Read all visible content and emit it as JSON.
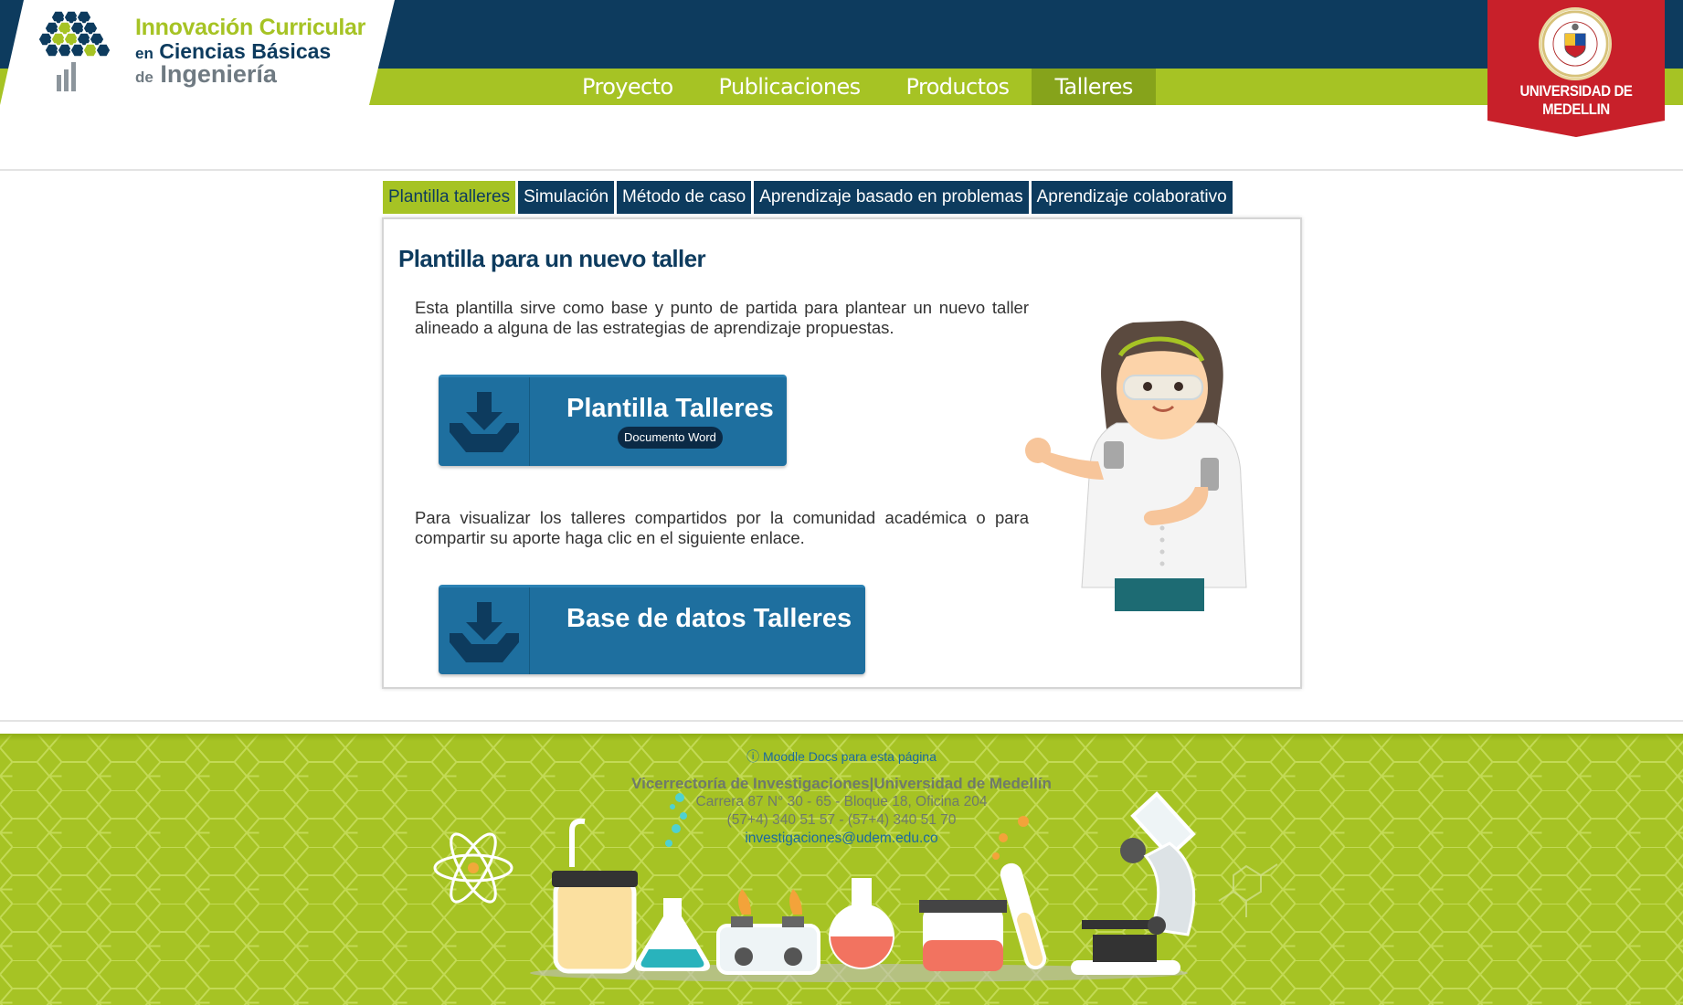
{
  "logo": {
    "line1": "Innovación Curricular",
    "line2_prefix": "en",
    "line2": "Ciencias Básicas",
    "line3_prefix": "de",
    "line3": "Ingeniería"
  },
  "main_nav": [
    {
      "label": "Proyecto",
      "active": false
    },
    {
      "label": "Publicaciones",
      "active": false
    },
    {
      "label": "Productos",
      "active": false
    },
    {
      "label": "Talleres",
      "active": true
    }
  ],
  "university": {
    "name": "UNIVERSIDAD DE MEDELLIN"
  },
  "tabs": [
    {
      "label": "Plantilla talleres",
      "active": true
    },
    {
      "label": "Simulación",
      "active": false
    },
    {
      "label": "Método de caso",
      "active": false
    },
    {
      "label": "Aprendizaje basado en problemas",
      "active": false
    },
    {
      "label": "Aprendizaje colaborativo",
      "active": false
    }
  ],
  "content": {
    "title": "Plantilla para un nuevo taller",
    "intro": "Esta plantilla sirve como base y punto de partida para plantear un nuevo taller alineado a alguna de las estrategias de aprendizaje propuestas.",
    "button1": {
      "label": "Plantilla Talleres",
      "badge": "Documento Word",
      "icon": "download-tray-icon"
    },
    "share_text": "Para visualizar los talleres compartidos por la comunidad académica o para compartir su aporte haga clic en el siguiente enlace.",
    "button2": {
      "label": "Base de datos Talleres",
      "icon": "download-tray-icon"
    }
  },
  "footer": {
    "moodle_docs": "Moodle Docs para esta página",
    "vicerrectoria": "Vicerrectoría de Investigaciones|Universidad de Medellín",
    "address": "Carrera 87 N° 30 - 65 - Bloque 18, Oficina 204",
    "phones": "(57+4) 340 51 57 - (57+4) 340 51 70",
    "email": "investigaciones@udem.edu.co"
  },
  "colors": {
    "navy": "#0d3b5e",
    "lime": "#a6c324",
    "button_blue": "#1e6f9f",
    "udem_red": "#c8202a"
  }
}
